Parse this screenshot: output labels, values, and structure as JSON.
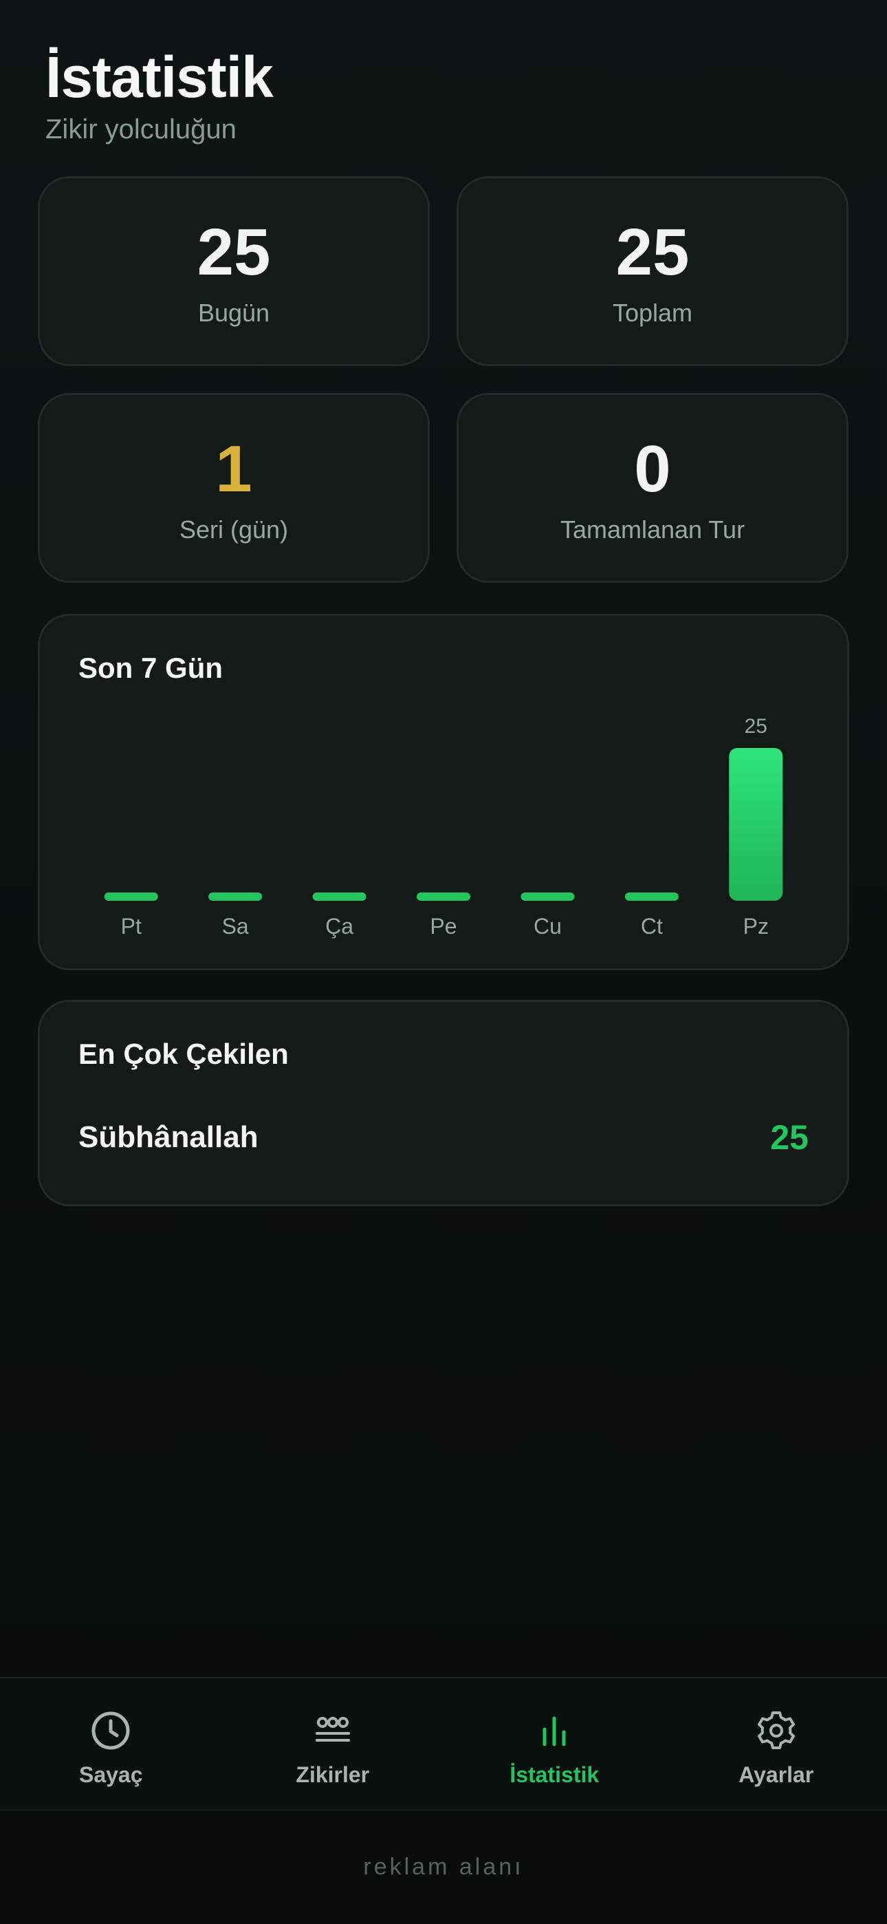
{
  "header": {
    "title": "İstatistik",
    "subtitle": "Zikir yolculuğun"
  },
  "stats": [
    {
      "value": "25",
      "label": "Bugün"
    },
    {
      "value": "25",
      "label": "Toplam"
    },
    {
      "value": "1",
      "label": "Seri (gün)"
    },
    {
      "value": "0",
      "label": "Tamamlanan Tur"
    }
  ],
  "chart_title": "Son 7 Gün",
  "chart_data": {
    "type": "bar",
    "title": "Son 7 Gün",
    "categories": [
      "Pt",
      "Sa",
      "Ça",
      "Pe",
      "Cu",
      "Ct",
      "Pz"
    ],
    "values": [
      0,
      0,
      0,
      0,
      0,
      0,
      25
    ],
    "data_labels": [
      "",
      "",
      "",
      "",
      "",
      "",
      "25"
    ],
    "ylim": [
      0,
      25
    ],
    "grid": false,
    "color": "#22c55e"
  },
  "top_zikir": {
    "title": "En Çok Çekilen",
    "name": "Sübhânallah",
    "count": "25"
  },
  "tabs": [
    {
      "label": "Sayaç",
      "icon": "clock-icon"
    },
    {
      "label": "Zikirler",
      "icon": "beads-icon"
    },
    {
      "label": "İstatistik",
      "icon": "bar-chart-icon"
    },
    {
      "label": "Ayarlar",
      "icon": "gear-icon"
    }
  ],
  "active_tab": "İstatistik",
  "ad_text": "reklam alanı",
  "colors": {
    "accent": "#22c55e",
    "streak": "#d9b23c",
    "background": "#0c1110",
    "card": "#131a18"
  }
}
